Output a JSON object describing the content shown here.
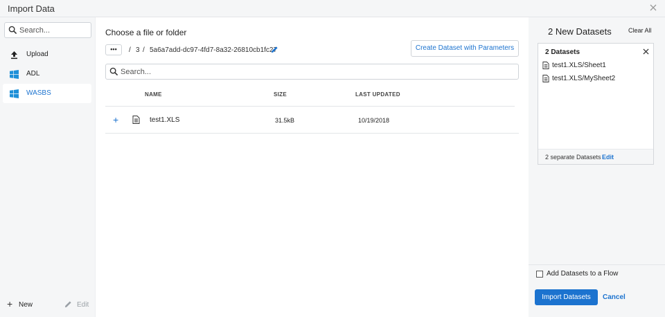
{
  "window": {
    "title": "Import Data",
    "close_icon": "close-icon"
  },
  "sidebar": {
    "search_placeholder": "Search...",
    "items": [
      {
        "label": "Upload",
        "icon": "upload-icon",
        "active": false
      },
      {
        "label": "ADL",
        "icon": "windows-icon",
        "active": false
      },
      {
        "label": "WASBS",
        "icon": "windows-icon",
        "active": true
      }
    ],
    "new_label": "New",
    "edit_label": "Edit"
  },
  "main": {
    "heading": "Choose a file or folder",
    "ellipsis_label": "•••",
    "breadcrumb": [
      "3",
      "5a6a7add-dc97-4fd7-8a32-26810cb1fc27"
    ],
    "breadcrumb_separator": "/",
    "create_button": "Create Dataset with Parameters",
    "search_placeholder": "Search...",
    "columns": {
      "name": "NAME",
      "size": "SIZE",
      "updated": "LAST UPDATED"
    },
    "rows": [
      {
        "name": "test1.XLS",
        "size": "31.5kB",
        "updated": "10/19/2018"
      }
    ]
  },
  "panel": {
    "title": "2 New Datasets",
    "clear_all": "Clear All",
    "box_header": "2 Datasets",
    "datasets": [
      "test1.XLS/Sheet1",
      "test1.XLS/MySheet2"
    ],
    "footer_count": "2 separate Datasets",
    "footer_edit": "Edit",
    "add_to_flow": "Add Datasets to a Flow",
    "add_to_flow_checked": false,
    "import_button": "Import Datasets",
    "cancel_button": "Cancel"
  },
  "colors": {
    "accent": "#1c73cf",
    "sidebar_bg": "#f5f6f7",
    "windows_blue": "#1e90d8"
  }
}
